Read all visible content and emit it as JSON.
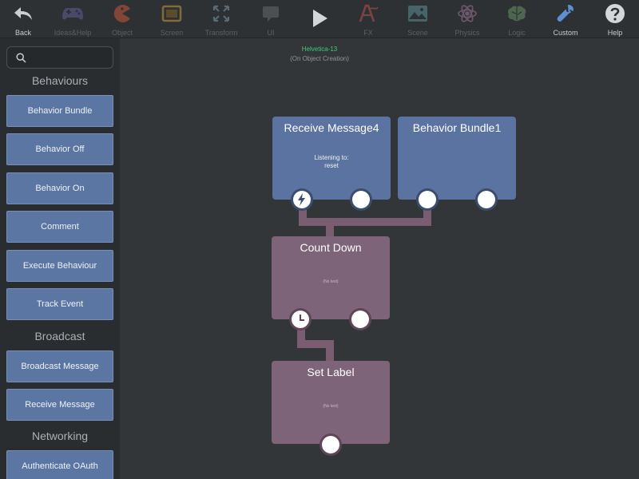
{
  "toolbar": {
    "items": [
      {
        "label": "Back",
        "icon": "back-arrow-icon",
        "enabled": true
      },
      {
        "label": "Ideas&Help",
        "icon": "gamepad-icon",
        "enabled": false
      },
      {
        "label": "Object",
        "icon": "pacman-icon",
        "enabled": false
      },
      {
        "label": "Screen",
        "icon": "screen-icon",
        "enabled": false
      },
      {
        "label": "Transform",
        "icon": "transform-arrows-icon",
        "enabled": false
      },
      {
        "label": "UI",
        "icon": "speech-bubble-icon",
        "enabled": false
      },
      {
        "label": "",
        "icon": "play-icon",
        "enabled": true
      },
      {
        "label": "FX",
        "icon": "fx-icon",
        "enabled": false
      },
      {
        "label": "Scene",
        "icon": "landscape-icon",
        "enabled": false
      },
      {
        "label": "Physics",
        "icon": "atom-icon",
        "enabled": false
      },
      {
        "label": "Logic",
        "icon": "brain-icon",
        "enabled": false
      },
      {
        "label": "Custom",
        "icon": "wrench-icon",
        "enabled": true
      },
      {
        "label": "Help",
        "icon": "help-icon",
        "enabled": true
      }
    ]
  },
  "sidebar": {
    "search_placeholder": "",
    "sections": [
      {
        "title": "Behaviours",
        "items": [
          "Behavior Bundle",
          "Behavior Off",
          "Behavior On",
          "Comment",
          "Execute Behaviour",
          "Track Event"
        ]
      },
      {
        "title": "Broadcast",
        "items": [
          "Broadcast Message",
          "Receive Message"
        ]
      },
      {
        "title": "Networking",
        "items": [
          "Authenticate OAuth"
        ]
      }
    ]
  },
  "canvas": {
    "object_name": "Helvetica-13",
    "event": "(On Object Creation)",
    "nodes": [
      {
        "title": "Receive Message4",
        "line1": "Listening to:",
        "line2": "reset"
      },
      {
        "title": "Behavior Bundle1"
      },
      {
        "title": "Count Down",
        "note": "(No text)"
      },
      {
        "title": "Set Label",
        "note": "(No text)"
      }
    ]
  },
  "colors": {
    "background": "#323639",
    "sidebar": "#2a2d30",
    "palette_button": "#5b76a3",
    "node_blue": "#5a73a0",
    "node_mauve": "#7e6478",
    "wire": "#7a5d71",
    "object_name": "#47c87a"
  }
}
